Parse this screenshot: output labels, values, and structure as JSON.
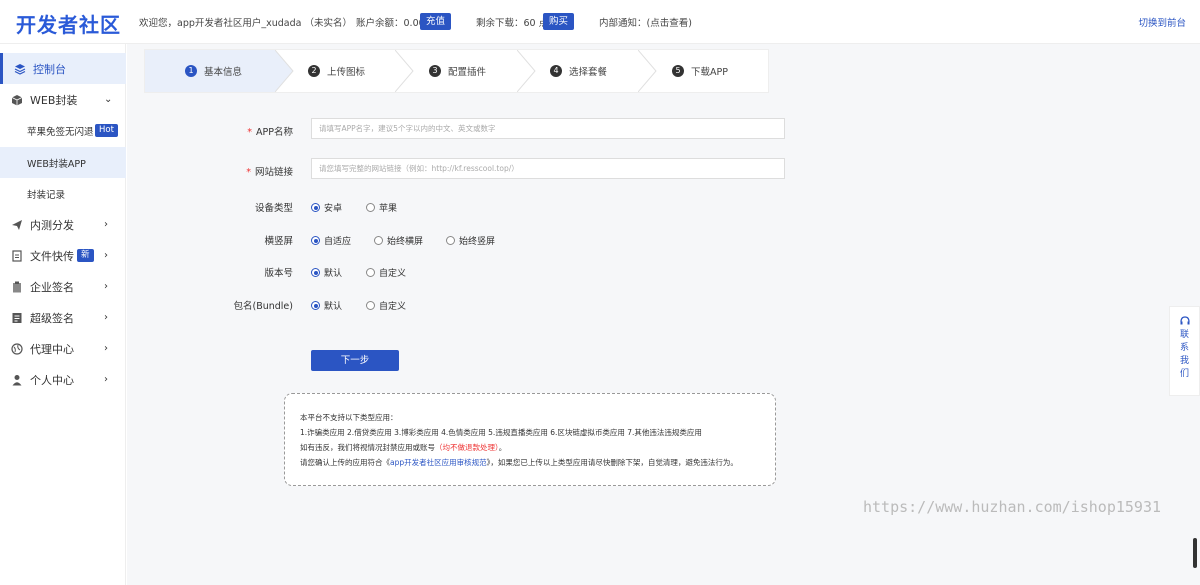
{
  "header": {
    "logo": "开发者社区",
    "welcome": "欢迎您，app开发者社区用户_xudada （未实名）",
    "balance_label": "账户余额：0.00",
    "recharge_button": "充值",
    "downloads_label": "剩余下载：60 点",
    "buy_button": "购买",
    "notice": "内部通知：(点击查看)",
    "switch_link": "切换到前台"
  },
  "sidebar": {
    "items": [
      {
        "label": "控制台",
        "icon": "layers-icon"
      },
      {
        "label": "WEB封装",
        "icon": "box-icon"
      },
      {
        "label": "苹果免签无闪退",
        "badge": "Hot"
      },
      {
        "label": "WEB封装APP"
      },
      {
        "label": "封装记录"
      },
      {
        "label": "内测分发",
        "icon": "send-icon"
      },
      {
        "label": "文件快传",
        "icon": "file-icon",
        "badge": "新"
      },
      {
        "label": "企业签名",
        "icon": "clipboard-icon"
      },
      {
        "label": "超级签名",
        "icon": "document-icon"
      },
      {
        "label": "代理中心",
        "icon": "globe-icon"
      },
      {
        "label": "个人中心",
        "icon": "user-icon"
      }
    ]
  },
  "steps": [
    {
      "num": "1",
      "label": "基本信息"
    },
    {
      "num": "2",
      "label": "上传图标"
    },
    {
      "num": "3",
      "label": "配置插件"
    },
    {
      "num": "4",
      "label": "选择套餐"
    },
    {
      "num": "5",
      "label": "下载APP"
    }
  ],
  "form": {
    "app_name_label": "APP名称",
    "app_name_placeholder": "请填写APP名字，建议5个字以内的中文、英文或数字",
    "url_label": "网站链接",
    "url_placeholder": "请您填写完整的网站链接（例如：http://kf.resscool.top/）",
    "device_label": "设备类型",
    "device_options": [
      "安卓",
      "苹果"
    ],
    "orientation_label": "横竖屏",
    "orientation_options": [
      "自适应",
      "始终横屏",
      "始终竖屏"
    ],
    "version_label": "版本号",
    "version_options": [
      "默认",
      "自定义"
    ],
    "bundle_label": "包名(Bundle)",
    "bundle_options": [
      "默认",
      "自定义"
    ],
    "next_button": "下一步"
  },
  "notice": {
    "line1": "本平台不支持以下类型应用：",
    "line2": "1.诈骗类应用 2.借贷类应用 3.博彩类应用 4.色情类应用 5.违规直播类应用 6.区块链虚拟币类应用 7.其他违法违规类应用",
    "line3_a": "如有违反，我们将视情况封禁应用或账号",
    "line3_red": "（均不做退款处理）",
    "line3_b": "。",
    "line4_a": "请您确认上传的应用符合《",
    "line4_link": "app开发者社区应用审核规范",
    "line4_b": "》，如果您已上传以上类型应用请尽快删除下架，自觉清理，避免违法行为。"
  },
  "contact": {
    "chars": [
      "联",
      "系",
      "我",
      "们"
    ],
    "icon": "headset-icon"
  },
  "watermark": "https://www.huzhan.com/ishop15931",
  "colors": {
    "accent": "#2b55c3",
    "danger": "#e33333"
  }
}
